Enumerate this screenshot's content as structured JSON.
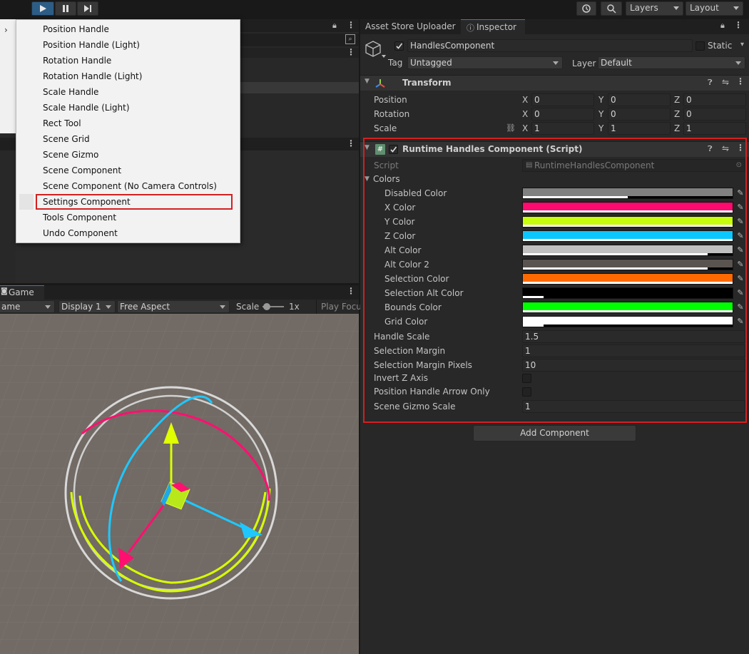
{
  "toolbar": {
    "layers_label": "Layers",
    "layout_label": "Layout"
  },
  "menu": {
    "items": [
      "Position Handle",
      "Position Handle (Light)",
      "Rotation Handle",
      "Rotation Handle (Light)",
      "Scale Handle",
      "Scale Handle (Light)",
      "Rect Tool",
      "Scene Grid",
      "Scene Gizmo",
      "Scene Component",
      "Scene Component (No Camera Controls)",
      "Settings Component",
      "Tools Component",
      "Undo Component"
    ],
    "highlighted": "Settings Component"
  },
  "game": {
    "tab_label": "Game",
    "view_dropdown": "ame",
    "display": "Display 1",
    "aspect": "Free Aspect",
    "scale_label": "Scale",
    "scale_value": "1x",
    "play_focus": "Play Focu"
  },
  "inspector": {
    "tabs": [
      "Asset Store Uploader",
      "Inspector"
    ],
    "object_name": "HandlesComponent",
    "static_label": "Static",
    "tag_label": "Tag",
    "tag_value": "Untagged",
    "layer_label": "Layer",
    "layer_value": "Default",
    "transform": {
      "title": "Transform",
      "rows": [
        {
          "label": "Position",
          "x": "0",
          "y": "0",
          "z": "0"
        },
        {
          "label": "Rotation",
          "x": "0",
          "y": "0",
          "z": "0"
        },
        {
          "label": "Scale",
          "x": "1",
          "y": "1",
          "z": "1"
        }
      ],
      "axis_x": "X",
      "axis_y": "Y",
      "axis_z": "Z"
    },
    "script_component": {
      "title": "Runtime Handles Component (Script)",
      "script_label": "Script",
      "script_value": "RuntimeHandlesComponent",
      "colors_label": "Colors",
      "colors": [
        {
          "label": "Disabled Color",
          "color": "#808080",
          "alpha": 0.5
        },
        {
          "label": "X Color",
          "color": "#ff0a6e",
          "alpha": 1.0
        },
        {
          "label": "Y Color",
          "color": "#c8ff0a",
          "alpha": 1.0
        },
        {
          "label": "Z Color",
          "color": "#0ac8ff",
          "alpha": 1.0
        },
        {
          "label": "Alt Color",
          "color": "#c0c0c0",
          "alpha": 0.88
        },
        {
          "label": "Alt Color 2",
          "color": "#5a5450",
          "alpha": 0.88
        },
        {
          "label": "Selection Color",
          "color": "#ff6a00",
          "alpha": 1.0
        },
        {
          "label": "Selection Alt Color",
          "color": "#000000",
          "alpha": 0.1
        },
        {
          "label": "Bounds Color",
          "color": "#00ff00",
          "alpha": 1.0
        },
        {
          "label": "Grid Color",
          "color": "#ffffff",
          "alpha": 0.1
        }
      ],
      "handle_scale_label": "Handle Scale",
      "handle_scale": "1.5",
      "selection_margin_label": "Selection Margin",
      "selection_margin": "1",
      "selection_margin_pixels_label": "Selection Margin Pixels",
      "selection_margin_pixels": "10",
      "invert_z_label": "Invert Z Axis",
      "pos_arrow_only_label": "Position Handle Arrow Only",
      "gizmo_scale_label": "Scene Gizmo Scale",
      "gizmo_scale": "1"
    },
    "add_component": "Add Component"
  }
}
